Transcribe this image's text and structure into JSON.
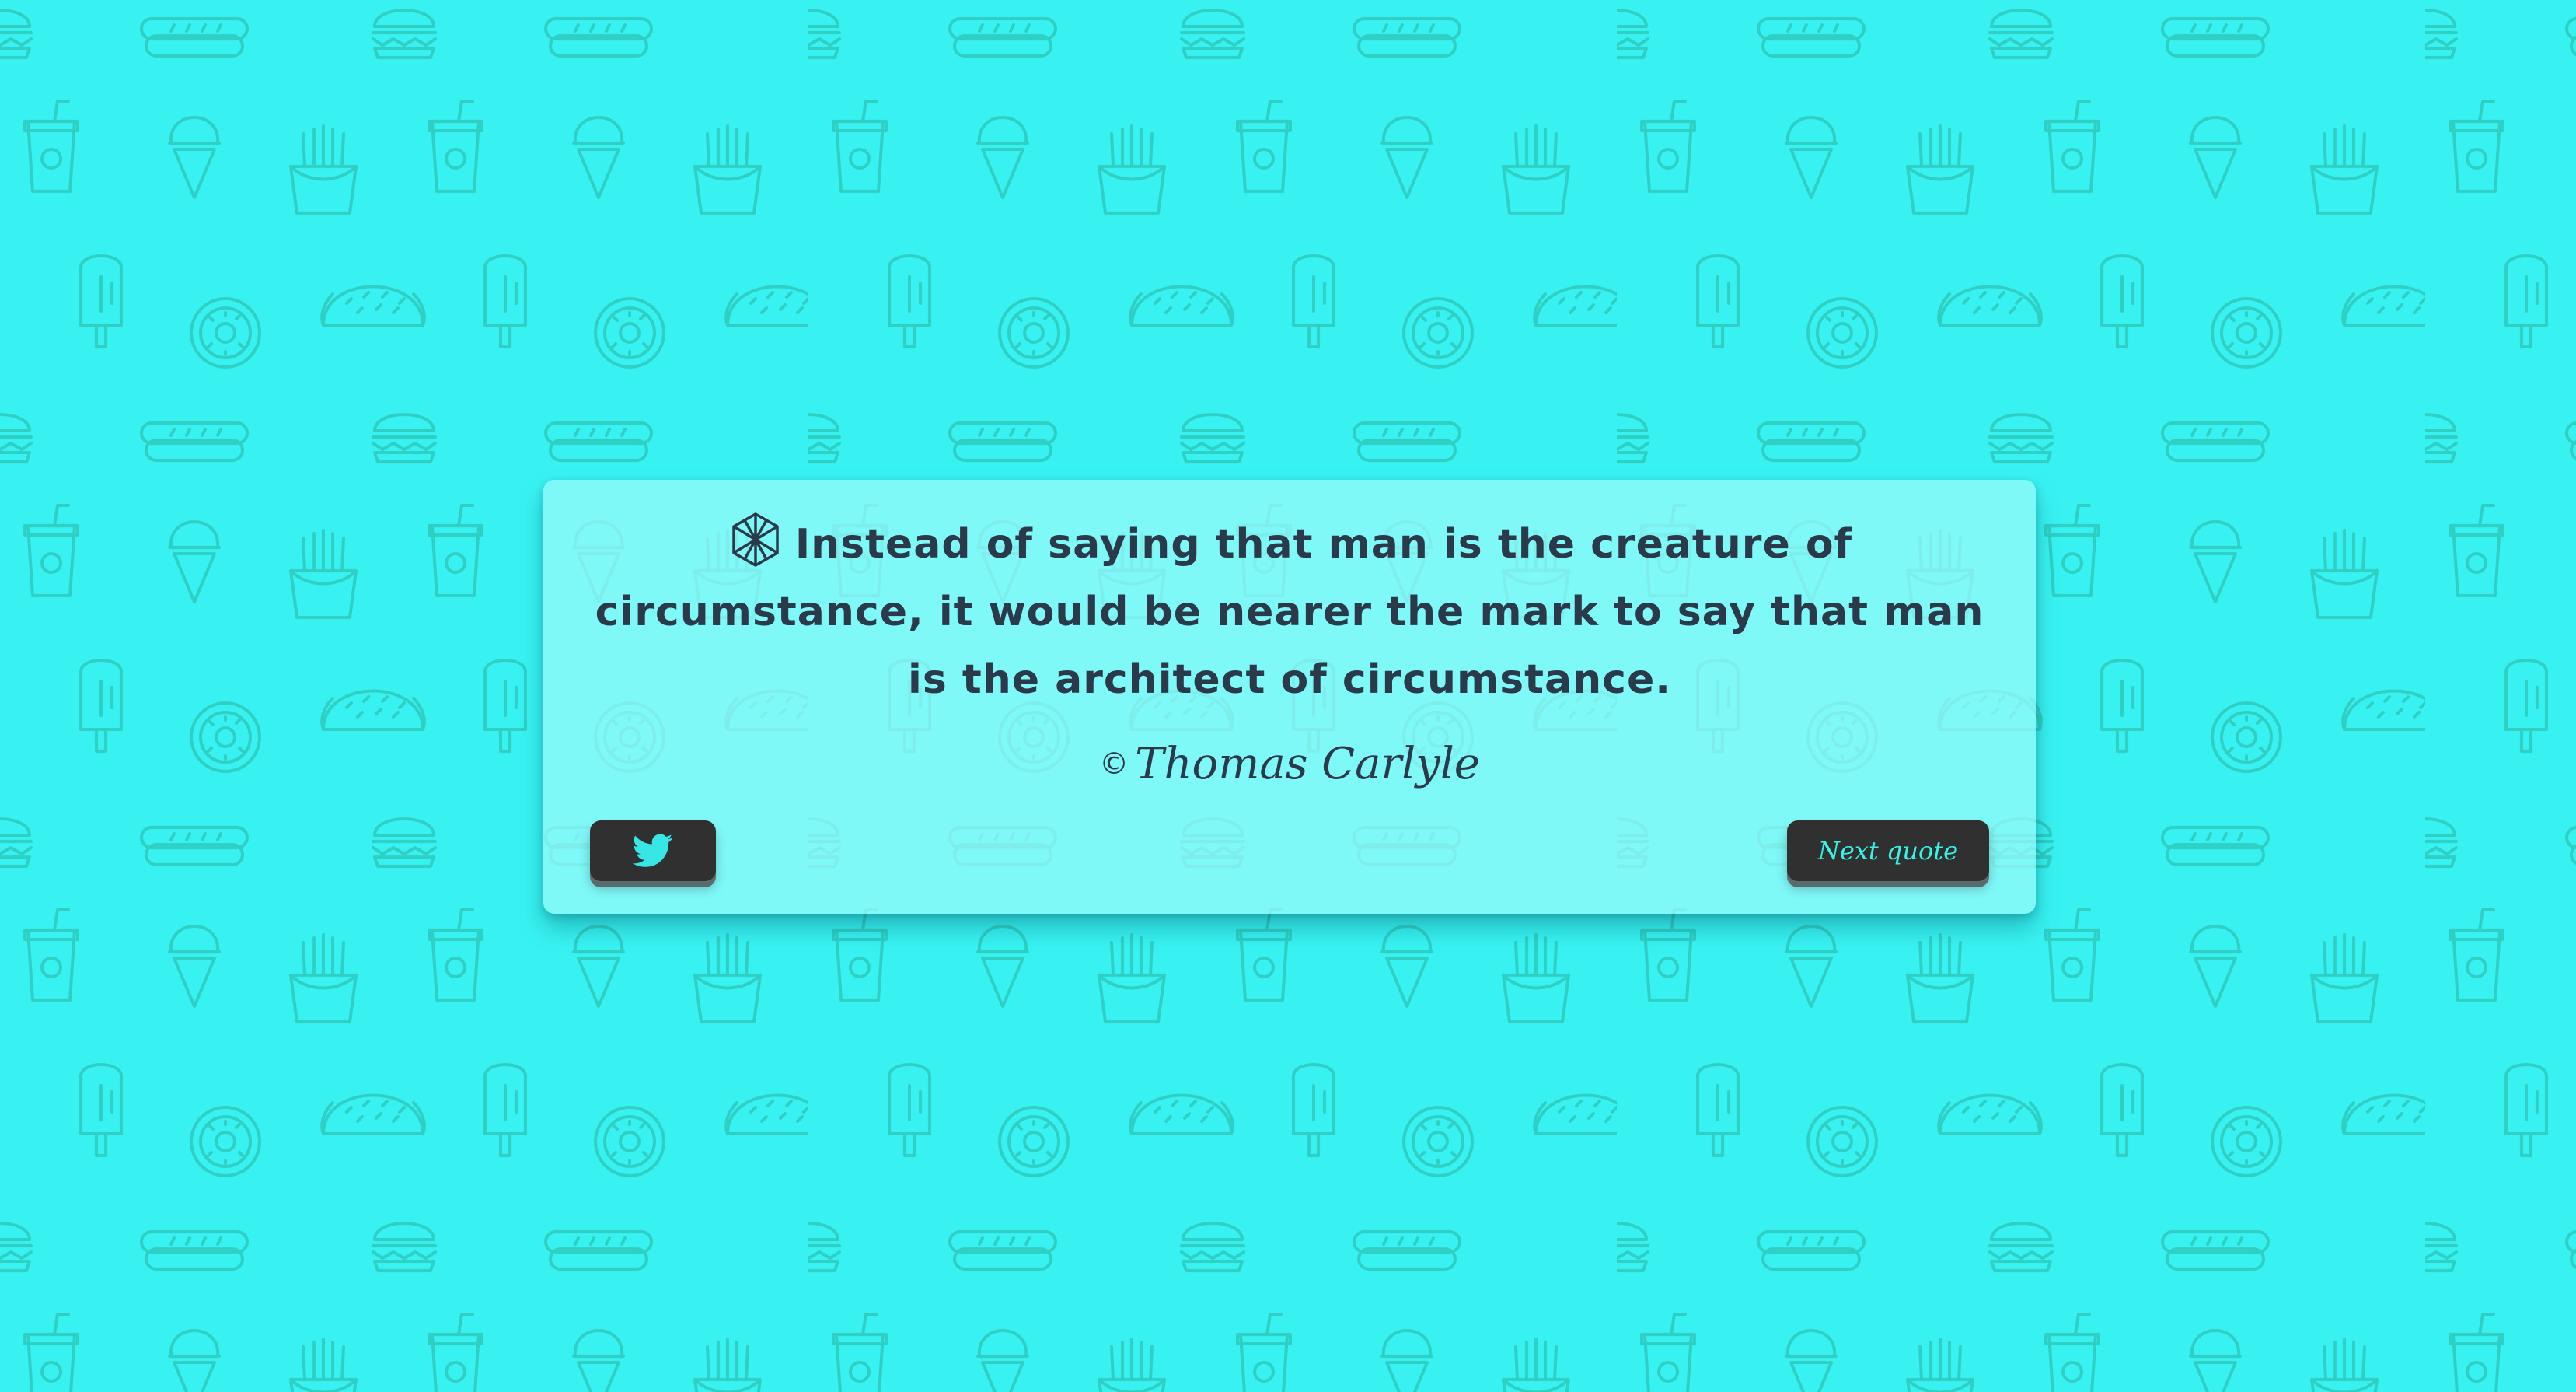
{
  "quote": {
    "text": "Instead of saying that man is the creature of circumstance, it would be nearer the mark to say that man is the architect of circumstance.",
    "author": "Thomas Carlyle",
    "copyright_symbol": "©"
  },
  "actions": {
    "tweet_icon": "twitter-bird-icon",
    "next_label": "Next quote"
  },
  "colors": {
    "background": "#38f2f2",
    "card": "#9bfafa",
    "text": "#2a3a4a",
    "button": "#303030",
    "accent": "#38f2e6"
  },
  "background_pattern_icons": [
    "hamburger-icon",
    "hotdog-icon",
    "soda-cup-icon",
    "ice-cream-cone-icon",
    "french-fries-icon",
    "popsicle-icon",
    "donut-icon",
    "taco-icon"
  ]
}
